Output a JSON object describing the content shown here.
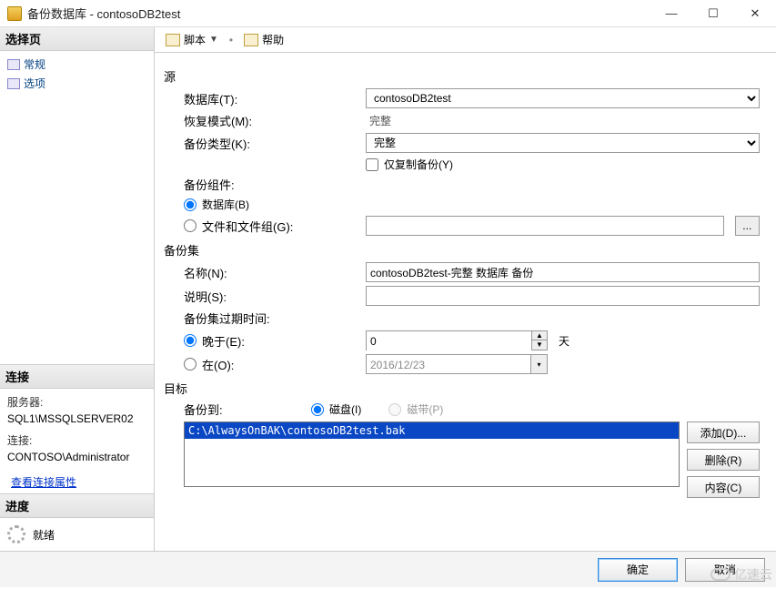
{
  "window": {
    "title": "备份数据库 - contosoDB2test"
  },
  "sidebar": {
    "select_page": "选择页",
    "items": [
      {
        "label": "常规"
      },
      {
        "label": "选项"
      }
    ],
    "connection_title": "连接",
    "server_label": "服务器:",
    "server_value": "SQL1\\MSSQLSERVER02",
    "conn_label": "连接:",
    "conn_value": "CONTOSO\\Administrator",
    "view_props": "查看连接属性",
    "progress_title": "进度",
    "progress_status": "就绪"
  },
  "toolbar": {
    "script": "脚本",
    "help": "帮助"
  },
  "form": {
    "source_group": "源",
    "database_label": "数据库(T):",
    "database_value": "contosoDB2test",
    "recovery_label": "恢复模式(M):",
    "recovery_value": "完整",
    "backup_type_label": "备份类型(K):",
    "backup_type_value": "完整",
    "copy_only_label": "仅复制备份(Y)",
    "component_label": "备份组件:",
    "component_db": "数据库(B)",
    "component_fg": "文件和文件组(G):",
    "set_group": "备份集",
    "name_label": "名称(N):",
    "name_value": "contosoDB2test-完整 数据库 备份",
    "desc_label": "说明(S):",
    "desc_value": "",
    "expire_label": "备份集过期时间:",
    "expire_after_label": "晚于(E):",
    "expire_after_value": "0",
    "expire_after_unit": "天",
    "expire_on_label": "在(O):",
    "expire_on_value": "2016/12/23",
    "dest_group": "目标",
    "backup_to_label": "备份到:",
    "disk_label": "磁盘(I)",
    "tape_label": "磁带(P)",
    "dest_path": "C:\\AlwaysOnBAK\\contosoDB2test.bak",
    "add_btn": "添加(D)...",
    "remove_btn": "删除(R)",
    "contents_btn": "内容(C)"
  },
  "footer": {
    "ok": "确定",
    "cancel": "取消"
  },
  "watermark": "亿速云"
}
